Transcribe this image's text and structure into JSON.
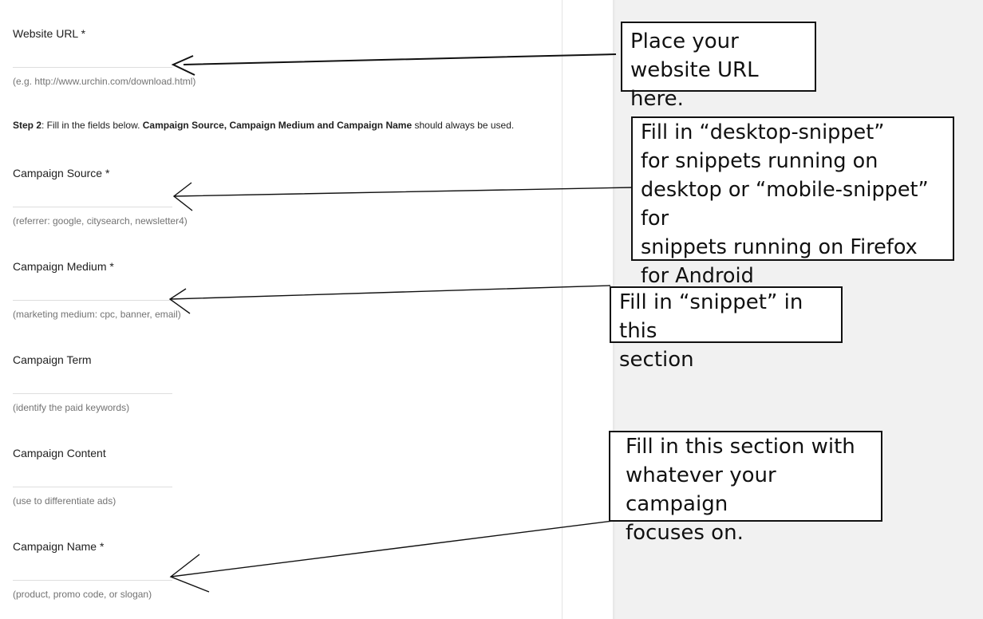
{
  "form": {
    "fields": [
      {
        "label": "Website URL *",
        "value": "",
        "hint": "(e.g. http://www.urchin.com/download.html)"
      },
      {
        "label": "Campaign Source *",
        "value": "",
        "hint": "(referrer: google, citysearch, newsletter4)"
      },
      {
        "label": "Campaign Medium *",
        "value": "",
        "hint": "(marketing medium: cpc, banner, email)"
      },
      {
        "label": "Campaign Term",
        "value": "",
        "hint": "(identify the paid keywords)"
      },
      {
        "label": "Campaign Content",
        "value": "",
        "hint": "(use to differentiate ads)"
      },
      {
        "label": "Campaign Name *",
        "value": "",
        "hint": "(product, promo code, or slogan)"
      }
    ],
    "step2": {
      "prefix": "Step 2",
      "text1": ": Fill in the fields below. ",
      "bold": "Campaign Source, Campaign Medium and Campaign Name",
      "text2": " should always be used."
    }
  },
  "annotations": {
    "url_note": "Place your\nwebsite URL here.",
    "source_note": "Fill in “desktop-snippet”\nfor snippets running on\ndesktop or “mobile-snippet” for\nsnippets running on Firefox\nfor Android",
    "medium_note": "Fill in “snippet” in this\nsection",
    "name_note": "Fill in this section with\nwhatever your campaign\nfocuses on."
  },
  "colors": {
    "annotation_border": "#111111",
    "right_panel_bg": "#f1f1f1",
    "hint_text": "#737373"
  }
}
